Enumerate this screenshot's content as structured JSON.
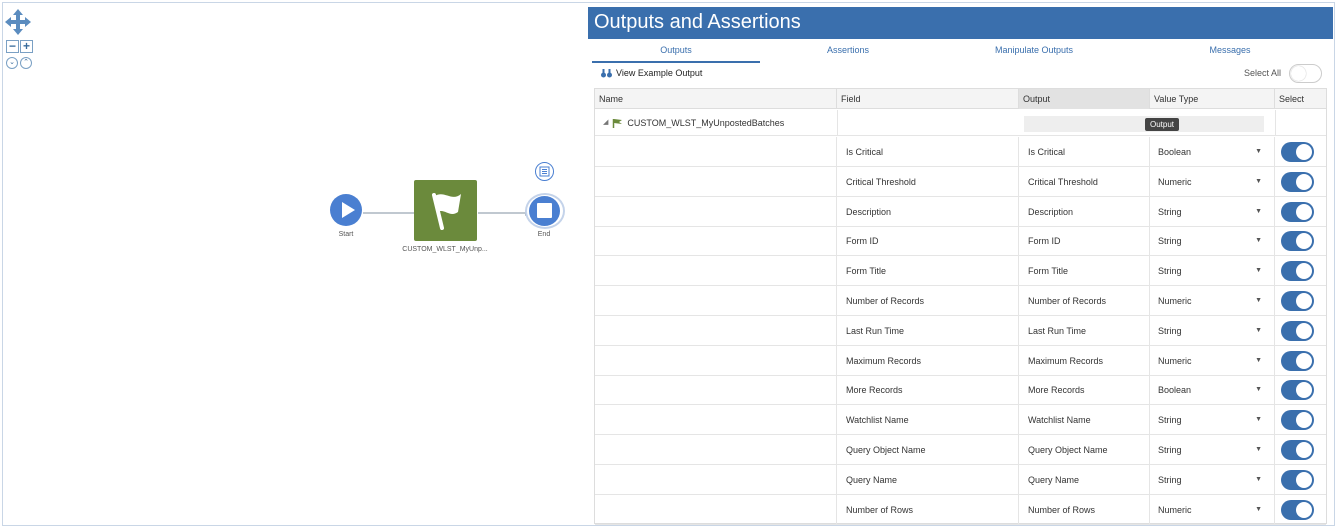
{
  "canvas": {
    "nodes": {
      "start_label": "Start",
      "task_label": "CUSTOM_WLST_MyUnp...",
      "end_label": "End"
    },
    "icons": {
      "pan": "move-arrows-icon",
      "zoom_out": "zoom-out-icon",
      "zoom_in": "zoom-in-icon",
      "expand": "expand-all-icon",
      "collapse": "collapse-all-icon"
    }
  },
  "panel": {
    "title": "Outputs and Assertions",
    "tabs": [
      {
        "label": "Outputs",
        "active": true
      },
      {
        "label": "Assertions",
        "active": false
      },
      {
        "label": "Manipulate Outputs",
        "active": false
      },
      {
        "label": "Messages",
        "active": false
      }
    ],
    "view_example_label": "View Example Output",
    "select_all_label": "Select All",
    "select_all_on": false,
    "columns": [
      "Name",
      "Field",
      "Output",
      "Value Type",
      "Select"
    ],
    "parent_row": {
      "name": "CUSTOM_WLST_MyUnpostedBatches",
      "tooltip": "Output"
    },
    "rows": [
      {
        "field": "Is Critical",
        "output": "Is Critical",
        "type": "Boolean",
        "selected": true
      },
      {
        "field": "Critical Threshold",
        "output": "Critical Threshold",
        "type": "Numeric",
        "selected": true
      },
      {
        "field": "Description",
        "output": "Description",
        "type": "String",
        "selected": true
      },
      {
        "field": "Form ID",
        "output": "Form ID",
        "type": "String",
        "selected": true
      },
      {
        "field": "Form Title",
        "output": "Form Title",
        "type": "String",
        "selected": true
      },
      {
        "field": "Number of Records",
        "output": "Number of Records",
        "type": "Numeric",
        "selected": true
      },
      {
        "field": "Last Run Time",
        "output": "Last Run Time",
        "type": "String",
        "selected": true
      },
      {
        "field": "Maximum Records",
        "output": "Maximum Records",
        "type": "Numeric",
        "selected": true
      },
      {
        "field": "More Records",
        "output": "More Records",
        "type": "Boolean",
        "selected": true
      },
      {
        "field": "Watchlist Name",
        "output": "Watchlist Name",
        "type": "String",
        "selected": true
      },
      {
        "field": "Query Object Name",
        "output": "Query Object Name",
        "type": "String",
        "selected": true
      },
      {
        "field": "Query Name",
        "output": "Query Name",
        "type": "String",
        "selected": true
      },
      {
        "field": "Number of Rows",
        "output": "Number of Rows",
        "type": "Numeric",
        "selected": true
      }
    ]
  },
  "colors": {
    "accent": "#3a6fad",
    "node_blue": "#4a7fd1",
    "task_green": "#6b8a3c"
  }
}
